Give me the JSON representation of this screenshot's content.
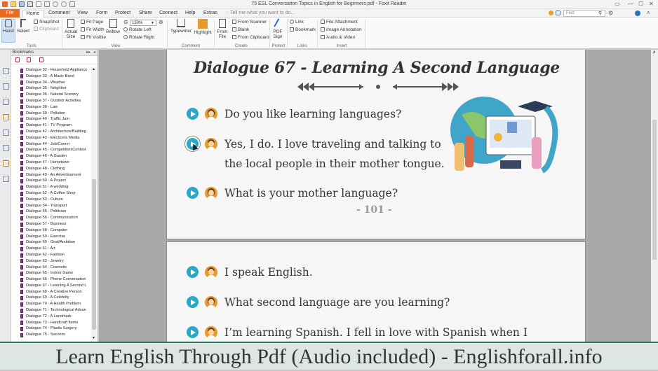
{
  "window": {
    "title": "75 ESL Conversation Topics in English for Beginners.pdf - Foxit Reader",
    "find_placeholder": "Find"
  },
  "menu": [
    "File",
    "Home",
    "Comment",
    "View",
    "Form",
    "Protect",
    "Share",
    "Connect",
    "Help",
    "Extras"
  ],
  "tell_me": "Tell me what you want to do...",
  "ribbon": {
    "tools": {
      "hand": "Hand",
      "select": "Select",
      "snapshot": "SnapShot",
      "clipboard": "Clipboard",
      "group": "Tools"
    },
    "view": {
      "actual_size": "Actual Size",
      "reflow": "Reflow",
      "fit_page": "Fit Page",
      "fit_width": "Fit Width",
      "fit_visible": "Fit Visible",
      "zoom": "150%",
      "rotate_left": "Rotate Left",
      "rotate_right": "Rotate Right",
      "group": "View"
    },
    "comment": {
      "typewriter": "Typewriter",
      "highlight": "Highlight",
      "group": "Comment"
    },
    "create": {
      "from_file": "From File",
      "from_scanner": "From Scanner",
      "blank": "Blank",
      "from_clipboard": "From Clipboard",
      "group": "Create"
    },
    "protect": {
      "pdf_sign": "PDF Sign",
      "group": "Protect"
    },
    "links": {
      "link": "Link",
      "bookmark": "Bookmark",
      "group": "Links"
    },
    "insert": {
      "file_attachment": "File Attachment",
      "image_annotation": "Image Annotation",
      "audio_video": "Audio & Video",
      "group": "Insert"
    }
  },
  "bookmarks": {
    "header": "Bookmarks",
    "items": [
      "Dialogue 32 - Household Appliance",
      "Dialogue 33 - A Music Band",
      "Dialogue 34 - Weather",
      "Dialogue 35 - Neighbor",
      "Dialogue 36 - Natural Scenery",
      "Dialogue 37 - Outdoor Activities",
      "Dialogue 38 - Law",
      "Dialogue 39 - Pollution",
      "Dialogue 40 - Traffic Jam",
      "Dialogue 41 - TV Program",
      "Dialogue 42 - Architecture/Building",
      "Dialogue 43 - Electronic Media",
      "Dialogue 44 - Job/Career",
      "Dialogue 45 - Competition/Contest",
      "Dialogue 46 - A Garden",
      "Dialogue 47 - Hometown",
      "Dialogue 48 - Clothing",
      "Dialogue 49 - An Advertisement",
      "Dialogue 50 - A Project",
      "Dialogue 51 - A wedding",
      "Dialogue 52 - A Coffee Shop",
      "Dialogue 53 - Culture",
      "Dialogue 54 - Transport",
      "Dialogue 55 - Politician",
      "Dialogue 56 - Communication",
      "Dialogue 57 - Business",
      "Dialogue 58 - Computer",
      "Dialogue 59 - Exercise",
      "Dialogue 60 - Goal/Ambition",
      "Dialogue 61 - Art",
      "Dialogue 62 - Fashion",
      "Dialogue 63 - Jewelry",
      "Dialogue 64 - Cosmetic",
      "Dialogue 65 - Indoor Game",
      "Dialogue 66 - Phone Conversation",
      "Dialogue 67 - Learning A Second L",
      "Dialogue 68 - A Creative Person",
      "Dialogue 69 - A Celebrity",
      "Dialogue 70 - A Health Problem",
      "Dialogue 71 - Technological Advan",
      "Dialogue 72 - A Landmark",
      "Dialogue 73 - Handcraft Items",
      "Dialogue 74 - Plastic Surgery",
      "Dialogue 75 - Success"
    ]
  },
  "page1": {
    "heading": "Dialogue 67 - Learning A Second Language",
    "lines": [
      "Do you like learning languages?",
      "Yes, I do. I love traveling and talking to",
      "the local people in their mother tongue.",
      "What is your mother language?"
    ],
    "page_number": "- 101 -"
  },
  "page2": {
    "lines": [
      "I speak English.",
      "What second language are you learning?",
      "I’m learning Spanish. I fell in love with Spanish when I"
    ]
  },
  "footer": "Learn English Through Pdf (Audio included) - Englishforall.info",
  "colors": {
    "accent": "#ea6a1f",
    "play": "#29a9c8",
    "footer_bar": "#2f7c5f"
  }
}
